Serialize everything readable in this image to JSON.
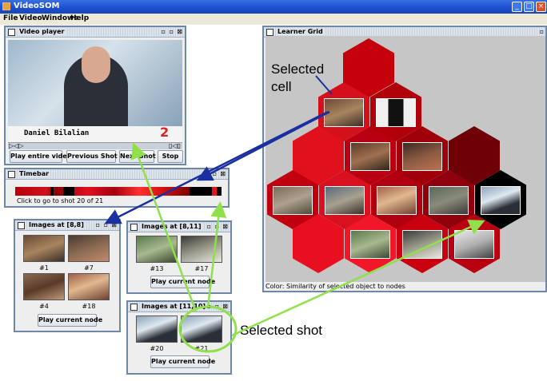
{
  "app": {
    "title": "VideoSOM",
    "icon": "app-icon"
  },
  "window_controls": [
    "minimize-icon",
    "maximize-icon",
    "close-icon"
  ],
  "menu": [
    "File",
    "Video",
    "Windows",
    "Help"
  ],
  "video_player": {
    "title": "Video player",
    "caption_name": "Daniel Bilalian",
    "channel_logo": "2",
    "buttons": [
      "Play entire video",
      "Previous Shot",
      "Next Shot",
      "Stop"
    ]
  },
  "timebar": {
    "title": "Timebar",
    "hint": "Click to go to shot 20 of 21"
  },
  "images_8_8": {
    "title": "Images at [8,8]",
    "items": [
      "#1",
      "#7",
      "#4",
      "#18"
    ],
    "button": "Play current node"
  },
  "images_8_11": {
    "title": "Images at [8,11]",
    "items": [
      "#13",
      "#17"
    ],
    "button": "Play current node"
  },
  "images_11_10": {
    "title": "Images at [11,10]",
    "items": [
      "#20",
      "#21"
    ],
    "button": "Play current node"
  },
  "learner_grid": {
    "title": "Learner Grid",
    "status": "Color: Similarity of selected object to nodes"
  },
  "annotations": {
    "selected_cell": "Selected cell",
    "selected_shot": "Selected shot"
  },
  "colors": {
    "accent": "#1c4fd0",
    "frame_border": "#6d87a6",
    "arrow_blue": "#1a2fa0",
    "arrow_green": "#8fe04a"
  }
}
